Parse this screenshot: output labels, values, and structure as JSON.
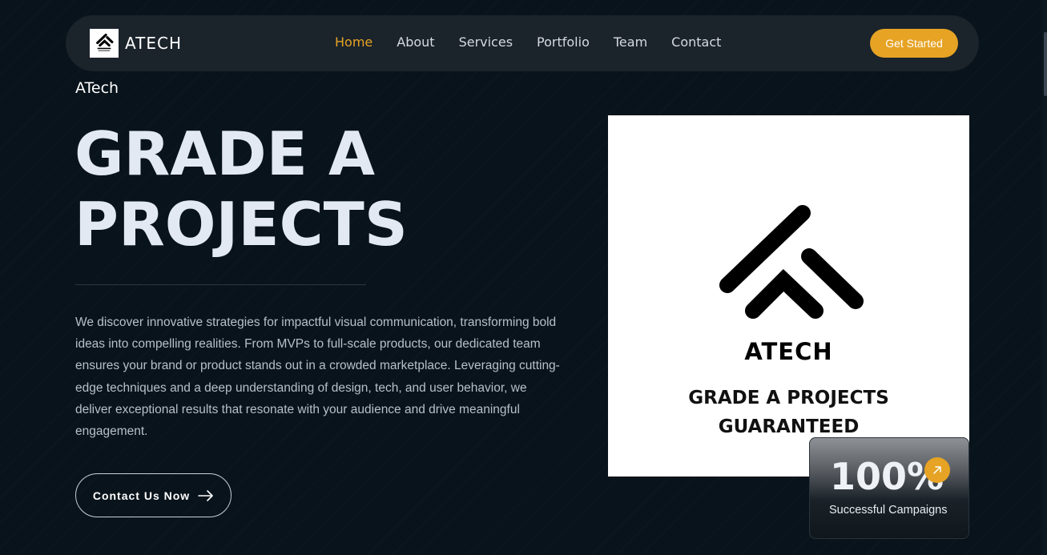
{
  "brand": {
    "name": "ATECH",
    "logo_icon": "atech-logo-icon"
  },
  "nav": {
    "links": [
      {
        "label": "Home",
        "active": true
      },
      {
        "label": "About",
        "active": false
      },
      {
        "label": "Services",
        "active": false
      },
      {
        "label": "Portfolio",
        "active": false
      },
      {
        "label": "Team",
        "active": false
      },
      {
        "label": "Contact",
        "active": false
      }
    ],
    "cta_label": "Get Started"
  },
  "hero": {
    "eyebrow": "ATech",
    "title_line1": "GRADE A",
    "title_line2": "PROJECTS",
    "description": "We discover innovative strategies for impactful visual communication, transforming bold ideas into compelling realities. From MVPs to full-scale products, our dedicated team ensures your brand or product stands out in a crowded marketplace. Leveraging cutting-edge techniques and a deep understanding of design, tech, and user behavior, we deliver exceptional results that resonate with your audience and drive meaningful engagement.",
    "contact_button_label": "Contact Us Now",
    "contact_button_icon": "arrow-right-icon"
  },
  "image_card": {
    "title": "ATECH",
    "tagline_line1": "GRADE A PROJECTS",
    "tagline_line2": "GUARANTEED"
  },
  "stat": {
    "value": "100%",
    "label": "Successful Campaigns",
    "icon": "arrow-up-right-icon"
  },
  "colors": {
    "accent": "#e6a324",
    "background": "#08131b",
    "navbar": "#1b232b",
    "heading": "#e3e9f2",
    "body_text": "#b7c0c8"
  }
}
